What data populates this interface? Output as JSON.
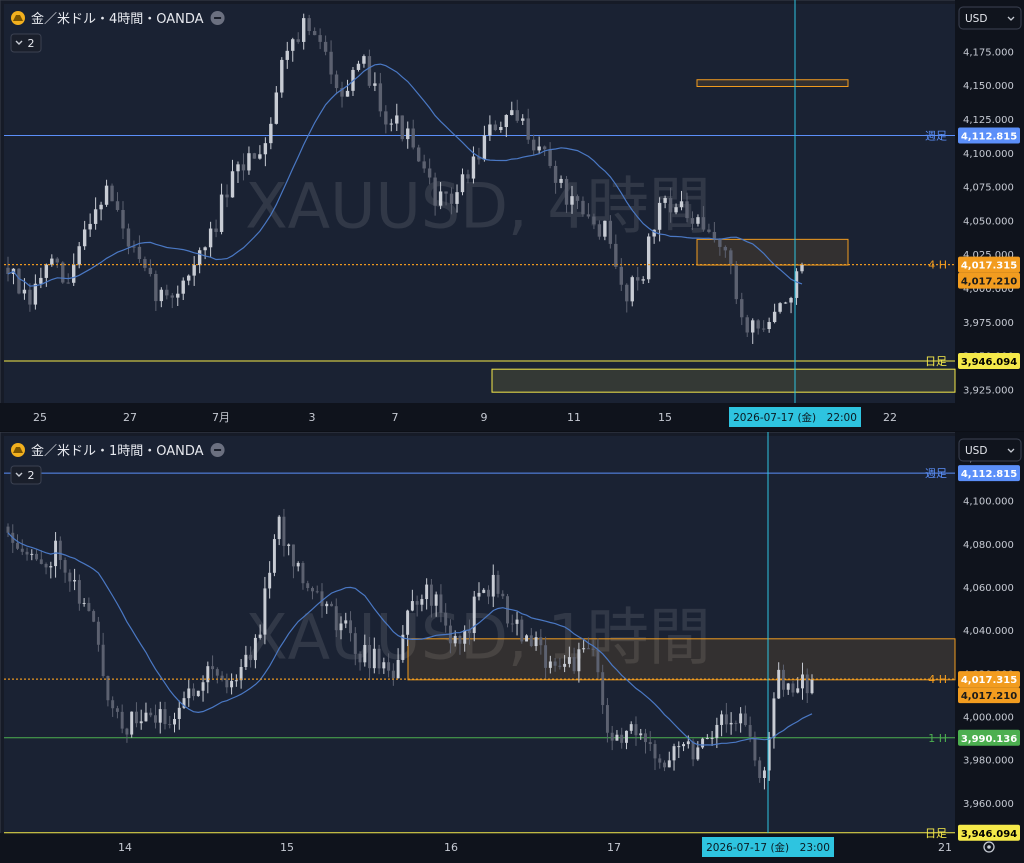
{
  "panels": [
    {
      "id": "p4h",
      "title": "金／米ドル・4時間・OANDA",
      "indicators_badge": "2",
      "watermark": "XAUUSD, 4時間",
      "currency": "USD",
      "y_ticks": [
        "4,200.000",
        "4,175.000",
        "4,150.000",
        "4,125.000",
        "4,100.000",
        "4,075.000",
        "4,050.000",
        "4,025.000",
        "4,000.000",
        "3,975.000",
        "3,950.000",
        "3,925.000"
      ],
      "x_ticks": [
        "25",
        "27",
        "7月",
        "3",
        "7",
        "9",
        "11",
        "15",
        "18",
        "22"
      ],
      "crosshair_label": "2026-07-17 (金)　22:00",
      "levels": [
        {
          "name": "weekly",
          "label": "週足",
          "value": "4,112.815",
          "color": "#5b8ff9",
          "badge_text": "#ffffff"
        },
        {
          "name": "four-hour",
          "label": "4 H",
          "value": "4,017.315",
          "color": "#f29c1f",
          "badge_text": "#ffffff"
        },
        {
          "name": "daily",
          "label": "日足",
          "value": "3,946.094",
          "color": "#f5e94a",
          "badge_text": "#000000"
        }
      ],
      "price_badge": "4,017.210"
    },
    {
      "id": "p1h",
      "title": "金／米ドル・1時間・OANDA",
      "indicators_badge": "2",
      "watermark": "XAUUSD, 1時間",
      "currency": "USD",
      "y_ticks": [
        "4,120.000",
        "4,100.000",
        "4,080.000",
        "4,060.000",
        "4,040.000",
        "4,020.000",
        "4,000.000",
        "3,980.000",
        "3,960.000"
      ],
      "x_ticks": [
        "14",
        "15",
        "16",
        "17",
        "21"
      ],
      "crosshair_label": "2026-07-17 (金)　23:00",
      "levels": [
        {
          "name": "weekly",
          "label": "週足",
          "value": "4,112.815",
          "color": "#5b8ff9",
          "badge_text": "#ffffff"
        },
        {
          "name": "four-hour",
          "label": "4 H",
          "value": "4,017.315",
          "color": "#f29c1f",
          "badge_text": "#ffffff"
        },
        {
          "name": "one-hour",
          "label": "1 H",
          "value": "3,990.136",
          "color": "#4caf50",
          "badge_text": "#ffffff"
        },
        {
          "name": "daily",
          "label": "日足",
          "value": "3,946.094",
          "color": "#f5e94a",
          "badge_text": "#000000"
        }
      ],
      "price_badge": "4,017.210"
    }
  ],
  "chart_data": [
    {
      "type": "candlestick",
      "symbol": "XAUUSD",
      "timeframe": "4時間",
      "ylim": [
        3915,
        4210
      ],
      "levels": [
        4112.815,
        4017.315,
        3946.094
      ],
      "zones": [
        {
          "name": "upper-zone",
          "y": [
            4149,
            4154
          ],
          "color": "#f29c1f"
        },
        {
          "name": "middle-zone",
          "y": [
            4017,
            4036
          ],
          "color": "#f29c1f"
        },
        {
          "name": "daily-zone",
          "y": [
            3923,
            3940
          ],
          "color": "#f5e94a"
        }
      ],
      "ma_color": "#4a78c4",
      "up_color": "#c8ccd4",
      "down_color": "#5c6170",
      "random_walk_seed": 7,
      "candle_count": 146,
      "close_anchors": [
        4015,
        3985,
        4020,
        4000,
        4050,
        4075,
        4035,
        4005,
        3990,
        4010,
        4030,
        4070,
        4095,
        4110,
        4180,
        4195,
        4170,
        4145,
        4165,
        4130,
        4115,
        4080,
        4060,
        4080,
        4110,
        4125,
        4120,
        4100,
        4070,
        4050,
        4045,
        3995,
        4015,
        4070,
        4055,
        4040,
        4035,
        3975,
        3970,
        3985,
        4017
      ]
    },
    {
      "type": "candlestick",
      "symbol": "XAUUSD",
      "timeframe": "1時間",
      "ylim": [
        3946,
        4130
      ],
      "levels": [
        4112.815,
        4017.315,
        3990.136,
        3946.094
      ],
      "zones": [
        {
          "name": "four-hour-zone",
          "y": [
            4017,
            4036
          ],
          "color": "#f29c1f"
        }
      ],
      "ma_color": "#4a78c4",
      "up_color": "#c8ccd4",
      "down_color": "#5c6170",
      "random_walk_seed": 11,
      "candle_count": 170,
      "close_anchors": [
        4088,
        4078,
        4068,
        4080,
        4060,
        4045,
        4010,
        3995,
        4000,
        3998,
        4002,
        4012,
        4025,
        4015,
        4022,
        4040,
        4090,
        4075,
        4062,
        4050,
        4042,
        4030,
        4026,
        4020,
        4050,
        4060,
        4045,
        4030,
        4055,
        4062,
        4045,
        4035,
        4028,
        4025,
        4026,
        4030,
        3985,
        3995,
        3985,
        3980,
        3990,
        3985,
        3995,
        4000,
        3998,
        3965,
        4020,
        4012,
        4017
      ]
    }
  ]
}
